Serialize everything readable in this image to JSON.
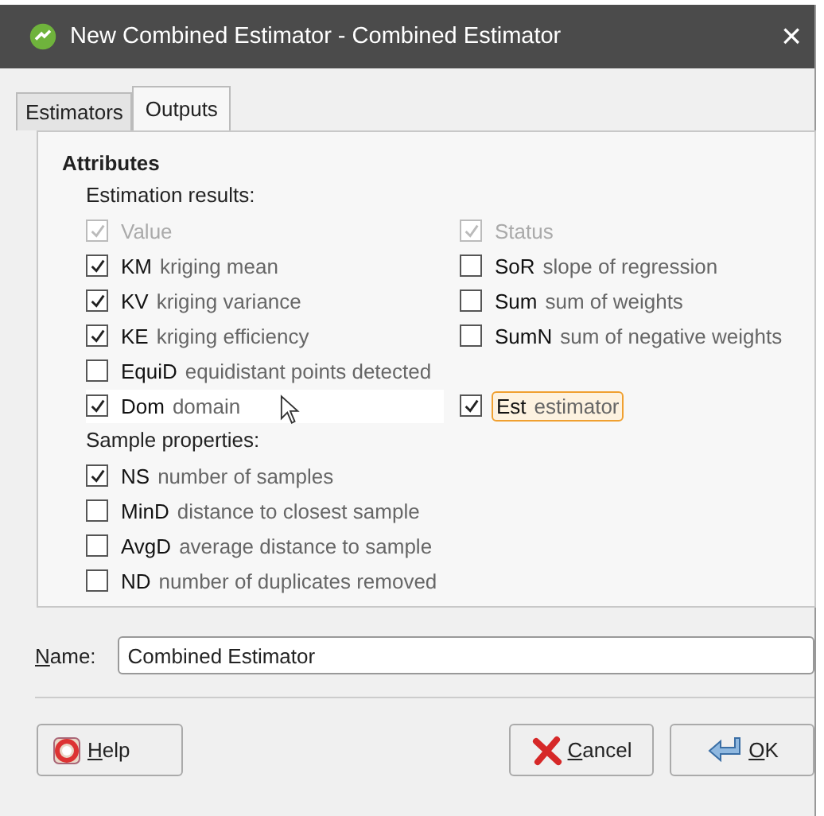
{
  "window": {
    "title": "New Combined Estimator - Combined Estimator",
    "close": "×"
  },
  "tabs": [
    {
      "label": "Estimators",
      "selected": false
    },
    {
      "label": "Outputs",
      "selected": true
    }
  ],
  "attributes": {
    "title": "Attributes",
    "rows": [
      {
        "kind": "heading",
        "label": "Estimation results:"
      },
      {
        "kind": "options",
        "left": {
          "label": "Value",
          "checked": true,
          "disabled": true
        },
        "right": {
          "label": "Status",
          "checked": true,
          "disabled": true
        }
      },
      {
        "kind": "options",
        "left": {
          "code": "KM",
          "desc": "kriging mean",
          "checked": true,
          "disabled": false
        },
        "right": {
          "code": "SoR",
          "desc": "slope of regression",
          "checked": false,
          "disabled": false
        }
      },
      {
        "kind": "options",
        "left": {
          "code": "KV",
          "desc": "kriging variance",
          "checked": true,
          "disabled": false
        },
        "right": {
          "code": "Sum",
          "desc": "sum of weights",
          "checked": false,
          "disabled": false
        }
      },
      {
        "kind": "options",
        "left": {
          "code": "KE",
          "desc": "kriging efficiency",
          "checked": true,
          "disabled": false
        },
        "right": {
          "code": "SumN",
          "desc": "sum of negative weights",
          "checked": false,
          "disabled": false
        }
      },
      {
        "kind": "options",
        "left": {
          "code": "EquiD",
          "desc": "equidistant points detected",
          "checked": false,
          "disabled": false
        }
      },
      {
        "kind": "options",
        "left": {
          "code": "Dom",
          "desc": "domain",
          "checked": true,
          "disabled": false,
          "hovered": true
        },
        "right": {
          "code": "Est",
          "desc": "estimator",
          "checked": true,
          "disabled": false,
          "focused": true
        }
      },
      {
        "kind": "heading",
        "label": "Sample properties:"
      },
      {
        "kind": "options",
        "left": {
          "code": "NS",
          "desc": "number of samples",
          "checked": true,
          "disabled": false
        }
      },
      {
        "kind": "options",
        "left": {
          "code": "MinD",
          "desc": "distance to closest sample",
          "checked": false,
          "disabled": false
        }
      },
      {
        "kind": "options",
        "left": {
          "code": "AvgD",
          "desc": "average distance to sample",
          "checked": false,
          "disabled": false
        }
      },
      {
        "kind": "options",
        "left": {
          "code": "ND",
          "desc": "number of duplicates removed",
          "checked": false,
          "disabled": false
        }
      }
    ]
  },
  "name": {
    "label": "Name:",
    "value": "Combined Estimator"
  },
  "buttons": [
    {
      "kind": "help",
      "label": "Help"
    },
    {
      "kind": "cancel",
      "label": "Cancel"
    },
    {
      "kind": "ok",
      "label": "OK"
    }
  ]
}
